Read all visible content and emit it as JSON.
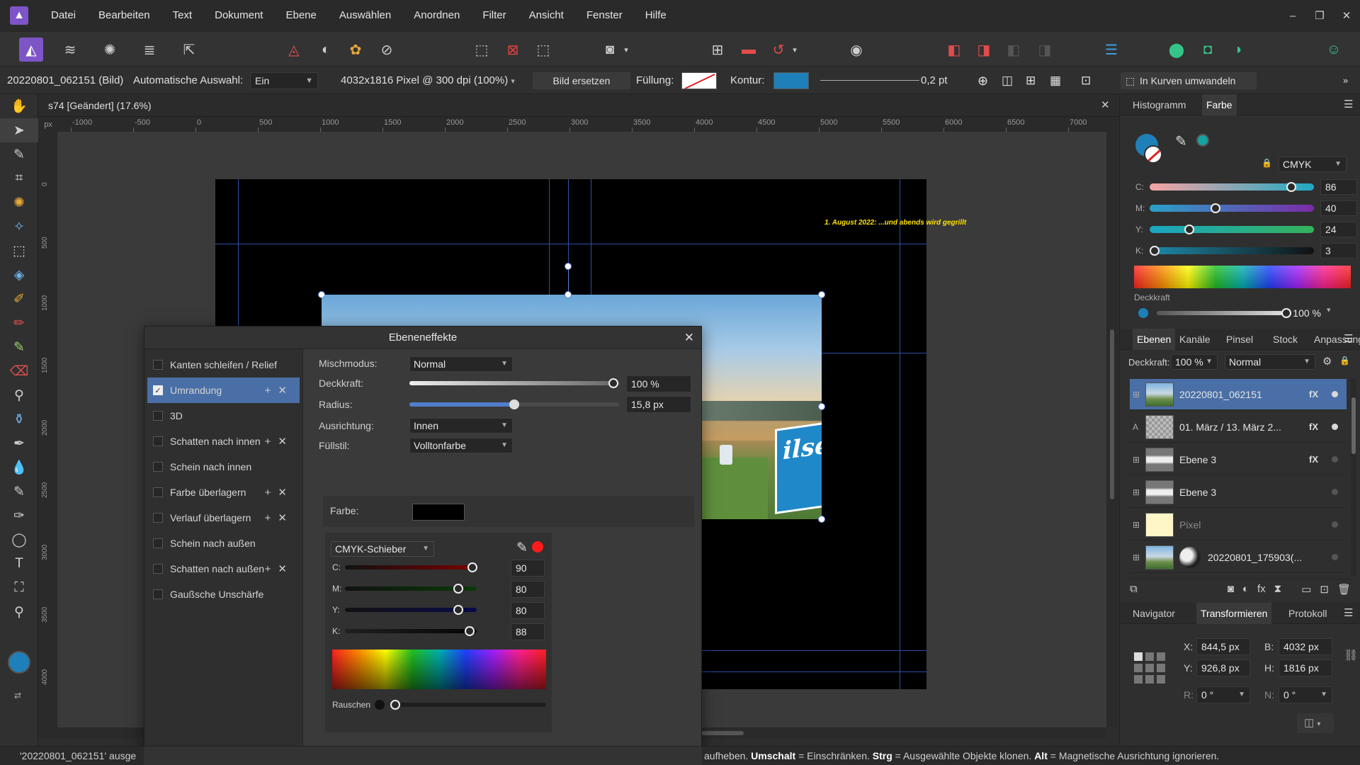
{
  "menu": [
    "Datei",
    "Bearbeiten",
    "Text",
    "Dokument",
    "Ebene",
    "Auswählen",
    "Anordnen",
    "Filter",
    "Ansicht",
    "Fenster",
    "Hilfe"
  ],
  "app_logo_icon": "affinity-photo-logo-icon",
  "context": {
    "object": "20220801_062151 (Bild)",
    "auto_select_label": "Automatische Auswahl:",
    "auto_select_value": "Ein",
    "image_info": "4032x1816 Pixel @ 300 dpi (100%)",
    "replace_button": "Bild ersetzen",
    "fill_label": "Füllung:",
    "stroke_label": "Kontur:",
    "stroke_width": "0,2 pt",
    "convert_button": "In Kurven umwandeln"
  },
  "document": {
    "tab_title": "s74 [Geändert] (17.6%)",
    "ruler_unit": "px",
    "ruler_top": [
      "-1000",
      "-500",
      "0",
      "500",
      "1000",
      "1500",
      "2000",
      "2500",
      "3000",
      "3500",
      "4000",
      "4500",
      "5000",
      "5500",
      "6000",
      "6500",
      "7000"
    ],
    "ruler_left": [
      "0",
      "500",
      "1000",
      "1500",
      "2000",
      "2500",
      "3000",
      "3500",
      "4000"
    ],
    "headline": "1. August 2022: ...und abends wird gegrillt",
    "sign_text": "ilse"
  },
  "dialog": {
    "title": "Ebeneneffekte",
    "effects": [
      {
        "label": "Kanten schleifen / Relief",
        "checked": false,
        "actions": false
      },
      {
        "label": "Umrandung",
        "checked": true,
        "actions": true
      },
      {
        "label": "3D",
        "checked": false,
        "actions": false
      },
      {
        "label": "Schatten nach innen",
        "checked": false,
        "actions": true
      },
      {
        "label": "Schein nach innen",
        "checked": false,
        "actions": false
      },
      {
        "label": "Farbe überlagern",
        "checked": false,
        "actions": true
      },
      {
        "label": "Verlauf überlagern",
        "checked": false,
        "actions": true
      },
      {
        "label": "Schein nach außen",
        "checked": false,
        "actions": false
      },
      {
        "label": "Schatten nach außen",
        "checked": false,
        "actions": true
      },
      {
        "label": "Gaußsche Unschärfe",
        "checked": false,
        "actions": false
      }
    ],
    "blend_label": "Mischmodus:",
    "blend_value": "Normal",
    "opacity_label": "Deckkraft:",
    "opacity_value": "100 %",
    "opacity_fraction": 1.0,
    "radius_label": "Radius:",
    "radius_value": "15,8 px",
    "radius_fraction": 0.5,
    "align_label": "Ausrichtung:",
    "align_value": "Innen",
    "fill_style_label": "Füllstil:",
    "fill_style_value": "Volltonfarbe",
    "color_label": "Farbe:",
    "color_value": "#000000",
    "picker_mode": "CMYK-Schieber",
    "cmyk": [
      {
        "label": "C:",
        "value": "90",
        "fraction": 0.9
      },
      {
        "label": "M:",
        "value": "80",
        "fraction": 0.8
      },
      {
        "label": "Y:",
        "value": "80",
        "fraction": 0.8
      },
      {
        "label": "K:",
        "value": "88",
        "fraction": 0.88
      }
    ],
    "noise_label": "Rauschen"
  },
  "color_panel": {
    "tabs": [
      "Histogramm",
      "Farbe"
    ],
    "active_tab": "Farbe",
    "mode": "CMYK",
    "primary": "#1f7fb8",
    "secondary": "#16a2a0",
    "sliders": [
      {
        "label": "C:",
        "value": "86",
        "fraction": 0.86
      },
      {
        "label": "M:",
        "value": "40",
        "fraction": 0.4
      },
      {
        "label": "Y:",
        "value": "24",
        "fraction": 0.24
      },
      {
        "label": "K:",
        "value": "3",
        "fraction": 0.03
      }
    ],
    "opacity_label": "Deckkraft",
    "opacity_value": "100 %"
  },
  "layers_panel": {
    "tabs": [
      "Ebenen",
      "Kanäle",
      "Pinsel",
      "Stock",
      "Anpassung"
    ],
    "active_tab": "Ebenen",
    "opacity_label": "Deckkraft:",
    "opacity_value": "100 %",
    "blend_value": "Normal",
    "layers": [
      {
        "name": "20220801_062151",
        "fx": true,
        "selected": true,
        "type": "image"
      },
      {
        "name": "01. März / 13. März 2...",
        "fx": true,
        "selected": false,
        "type": "text",
        "badge": "A"
      },
      {
        "name": "Ebene 3",
        "fx": true,
        "selected": false,
        "type": "pixel"
      },
      {
        "name": "Ebene 3",
        "fx": false,
        "selected": false,
        "type": "pixel"
      },
      {
        "name": "Pixel",
        "fx": false,
        "selected": false,
        "type": "pixel",
        "dim": true
      },
      {
        "name": "20220801_175903(...",
        "fx": false,
        "selected": false,
        "type": "image"
      }
    ]
  },
  "transform_panel": {
    "tabs": [
      "Navigator",
      "Transformieren",
      "Protokoll"
    ],
    "active_tab": "Transformieren",
    "x": "844,5 px",
    "y": "926,8 px",
    "w": "4032 px",
    "h": "1816 px",
    "r": "0 °",
    "s": "0 °"
  },
  "status": {
    "left": "'20220801_062151' ausge",
    "right_parts": [
      {
        "t": "aufheben. ",
        "b": false
      },
      {
        "t": "Umschalt",
        "b": true
      },
      {
        "t": " = Einschränken. ",
        "b": false
      },
      {
        "t": "Strg",
        "b": true
      },
      {
        "t": " = Ausgewählte Objekte klonen. ",
        "b": false
      },
      {
        "t": "Alt",
        "b": true
      },
      {
        "t": " = Magnetische Ausrichtung ignorieren.",
        "b": false
      }
    ]
  }
}
